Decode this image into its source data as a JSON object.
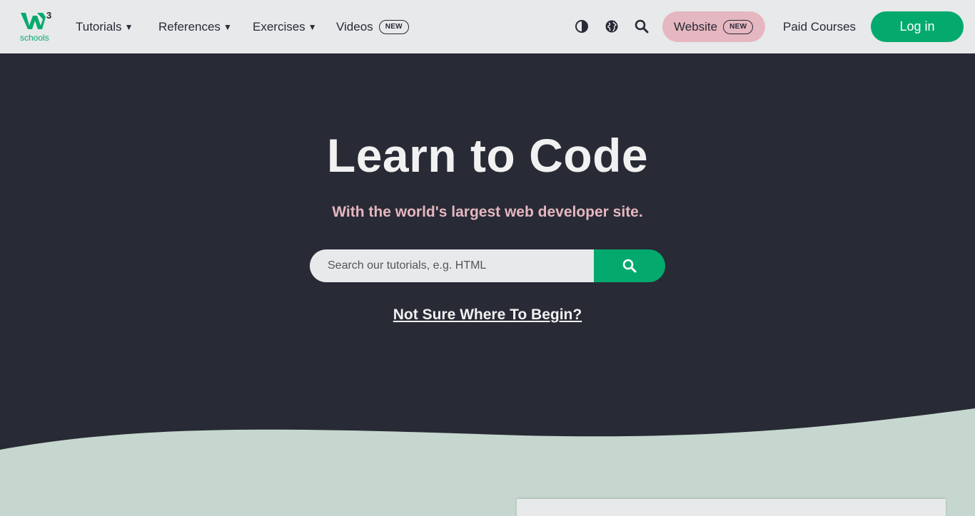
{
  "nav": {
    "logo_alt": "W3Schools",
    "tutorials": "Tutorials",
    "references": "References",
    "exercises": "Exercises",
    "videos": "Videos",
    "videos_badge": "NEW",
    "website": "Website",
    "website_badge": "NEW",
    "paid_courses": "Paid Courses",
    "login": "Log in",
    "icons": [
      "contrast-icon",
      "globe-icon",
      "search-icon"
    ]
  },
  "hero": {
    "title": "Learn to Code",
    "subtitle": "With the world's largest web developer site.",
    "search_placeholder": "Search our tutorials, e.g. HTML",
    "begin_link": "Not Sure Where To Begin?"
  },
  "colors": {
    "nav_bg": "#E7E9EB",
    "hero_bg": "#282A35",
    "accent_green": "#04AA6D",
    "accent_pink": "#E5B7C0",
    "wave_bg": "#C5D7CE"
  }
}
